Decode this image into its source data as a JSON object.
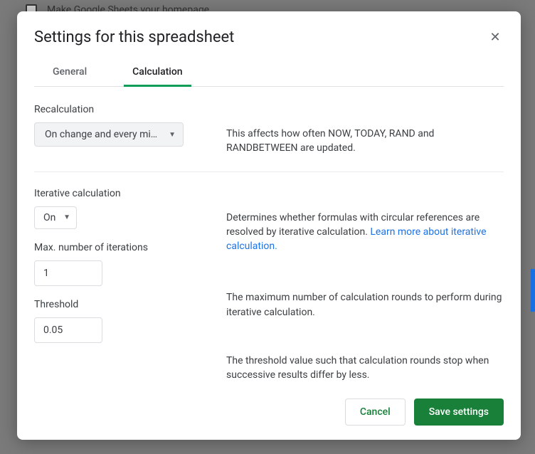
{
  "background": {
    "checkbox_text": "Make Google Sheets your homepage"
  },
  "dialog": {
    "title": "Settings for this spreadsheet",
    "tabs": {
      "general": "General",
      "calculation": "Calculation"
    },
    "recalculation": {
      "label": "Recalculation",
      "selected": "On change and every min…",
      "description": "This affects how often NOW, TODAY, RAND and RANDBETWEEN are updated."
    },
    "iterative": {
      "label": "Iterative calculation",
      "selected": "On",
      "description": "Determines whether formulas with circular references are resolved by iterative calculation. ",
      "link": "Learn more about iterative calculation."
    },
    "max_iterations": {
      "label": "Max. number of iterations",
      "value": "1",
      "description": "The maximum number of calculation rounds to perform during iterative calculation."
    },
    "threshold": {
      "label": "Threshold",
      "value": "0.05",
      "description": "The threshold value such that calculation rounds stop when successive results differ by less."
    },
    "buttons": {
      "cancel": "Cancel",
      "save": "Save settings"
    }
  }
}
